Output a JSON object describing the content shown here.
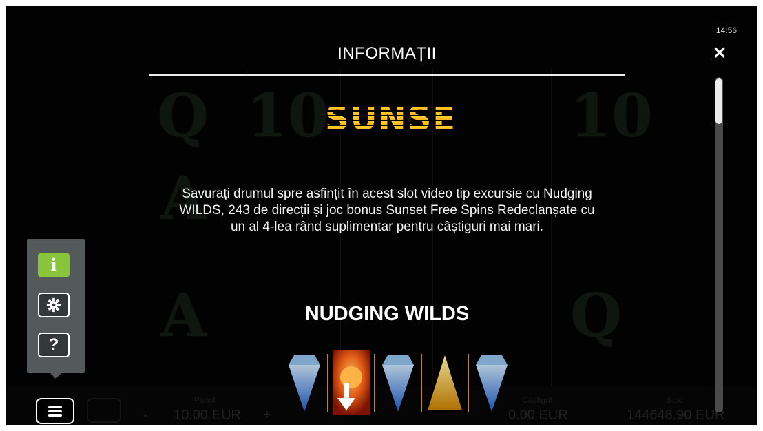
{
  "status_bar": {
    "time": "14:56"
  },
  "dialog": {
    "title": "INFORMAȚII",
    "close_icon": "close-icon",
    "logo_text": "SUNSET",
    "description": "Savurați drumul spre asfințit în acest slot video tip excursie cu Nudging WILDS, 243 de direcții și joc bonus Sunset Free Spins Redeclanșate cu un al 4-lea rând suplimentar pentru câștiguri mai mari.",
    "section_title": "NUDGING WILDS",
    "scroll_position": 0.02
  },
  "side_menu": {
    "items": [
      {
        "icon": "info-icon",
        "glyph": "i",
        "active": true
      },
      {
        "icon": "gear-icon",
        "active": false
      },
      {
        "icon": "help-icon",
        "glyph": "?",
        "active": false
      }
    ],
    "toggle_icon": "menu-icon"
  },
  "bottom_bar": {
    "bet_label": "Pariul",
    "bet_value": "10.00 EUR",
    "minus": "-",
    "plus": "+",
    "win_label": "Câștigul",
    "win_value": "0.00 EUR",
    "balance_label": "Sold",
    "balance_value": "144648.90 EUR"
  },
  "colors": {
    "accent_green": "#8ac33c",
    "logo_gold": "#ffc12a",
    "background": "#020203"
  }
}
